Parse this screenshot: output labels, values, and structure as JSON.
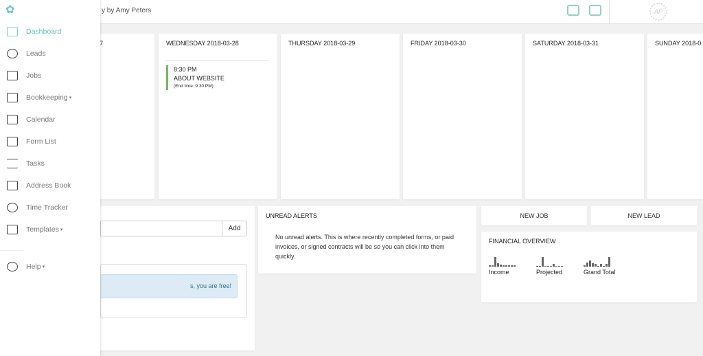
{
  "header": {
    "studio_name": "y by Amy Peters",
    "icons": [
      "inbox-icon",
      "archive-icon"
    ],
    "logo_text": "AP"
  },
  "sidebar": {
    "items": [
      {
        "label": "Dashboard",
        "icon": "dashboard-icon",
        "active": true
      },
      {
        "label": "Leads",
        "icon": "leads-icon"
      },
      {
        "label": "Jobs",
        "icon": "briefcase-icon"
      },
      {
        "label": "Bookkeeping",
        "icon": "bookkeeping-icon",
        "dropdown": true
      },
      {
        "label": "Calendar",
        "icon": "calendar-icon"
      },
      {
        "label": "Form List",
        "icon": "form-list-icon"
      },
      {
        "label": "Tasks",
        "icon": "tasks-icon"
      },
      {
        "label": "Address Book",
        "icon": "address-book-icon"
      },
      {
        "label": "Time Tracker",
        "icon": "stopwatch-icon"
      },
      {
        "label": "Templates",
        "icon": "templates-icon",
        "dropdown": true
      }
    ],
    "help": "Help",
    "caret": "▾"
  },
  "week": {
    "days": [
      {
        "label": "7"
      },
      {
        "label": "WEDNESDAY 2018-03-28",
        "events": [
          {
            "time": "8:30 PM",
            "title": "ABOUT WEBSITE",
            "end": "(End time: 9:30 PM)"
          }
        ]
      },
      {
        "label": "THURSDAY 2018-03-29"
      },
      {
        "label": "FRIDAY 2018-03-30"
      },
      {
        "label": "SATURDAY 2018-03-31"
      },
      {
        "label": "SUNDAY 2018-0"
      }
    ]
  },
  "tasks": {
    "add_label": "Add",
    "input_value": "",
    "empty_message": "s, you are free!"
  },
  "unread_alerts": {
    "title": "UNREAD ALERTS",
    "message": "No unread alerts. This is where recently completed forms, or paid invoices, or signed contracts will be so you can click into them quickly."
  },
  "actions": {
    "new_job": "NEW JOB",
    "new_lead": "NEW LEAD"
  },
  "financial": {
    "title": "FINANCIAL OVERVIEW",
    "series": [
      {
        "label": "Income",
        "values": [
          1,
          1,
          9,
          3,
          2,
          1,
          1,
          1,
          1,
          1
        ]
      },
      {
        "label": "Projected",
        "values": [
          1,
          1,
          12,
          1,
          1,
          1,
          3,
          1,
          1,
          1
        ]
      },
      {
        "label": "Grand Total",
        "values": [
          2,
          5,
          8,
          4,
          3,
          1,
          3,
          1,
          3,
          12
        ]
      }
    ]
  }
}
